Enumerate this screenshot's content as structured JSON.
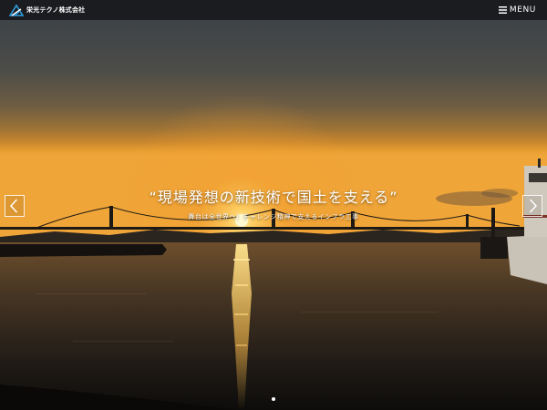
{
  "header": {
    "logo_text": "栄光テクノ株式会社",
    "menu_label": "MENU"
  },
  "hero": {
    "title": "“現場発想の新技術で国土を支える”",
    "subtitle": "舞台は全世界へ！チャレンジ精神で支えるインフラ工事"
  },
  "carousel": {
    "active_slide": 1,
    "slide_count": 1
  },
  "colors": {
    "header_bg": "#1b1c1f",
    "logo_accent": "#2f9fe0",
    "sky_top": "#3e4347",
    "sky_horizon": "#f0a030",
    "sun": "#fff6c0"
  },
  "icons": {
    "logo": "company-logo-mark",
    "menu": "hamburger-icon",
    "prev": "chevron-left-icon",
    "next": "chevron-right-icon"
  }
}
